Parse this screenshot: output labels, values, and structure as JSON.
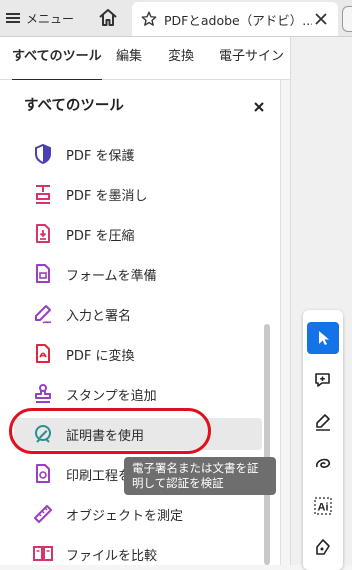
{
  "topbar": {
    "menu_label": "メニュー",
    "tab_title": "PDFとadobe（アドビ）..."
  },
  "tabs": [
    {
      "label": "すべてのツール",
      "active": true
    },
    {
      "label": "編集",
      "active": false
    },
    {
      "label": "変換",
      "active": false
    },
    {
      "label": "電子サイン",
      "active": false
    }
  ],
  "panel": {
    "title": "すべてのツール",
    "items": [
      {
        "label": "PDF を保護",
        "icon": "shield-icon",
        "color": "#4b3fb5"
      },
      {
        "label": "PDF を墨消し",
        "icon": "redact-icon",
        "color": "#d8336d"
      },
      {
        "label": "PDF を圧縮",
        "icon": "compress-icon",
        "color": "#d8336d"
      },
      {
        "label": "フォームを準備",
        "icon": "form-icon",
        "color": "#9b3fc2"
      },
      {
        "label": "入力と署名",
        "icon": "sign-pen-icon",
        "color": "#9b3fc2"
      },
      {
        "label": "PDF に変換",
        "icon": "convert-pdf-icon",
        "color": "#e0263f"
      },
      {
        "label": "スタンプを追加",
        "icon": "stamp-icon",
        "color": "#9b3fc2"
      },
      {
        "label": "証明書を使用",
        "icon": "certificate-icon",
        "color": "#2c8f8f"
      },
      {
        "label": "印刷工程を",
        "icon": "print-production-icon",
        "color": "#9b3fc2"
      },
      {
        "label": "オブジェクトを測定",
        "icon": "ruler-icon",
        "color": "#9b3fc2"
      },
      {
        "label": "ファイルを比較",
        "icon": "compare-icon",
        "color": "#d8336d"
      }
    ]
  },
  "tooltip": {
    "text": "電子署名または文書を証明して認証を検証"
  },
  "colors": {
    "highlight": "#e0101e",
    "accent": "#1473e6"
  }
}
